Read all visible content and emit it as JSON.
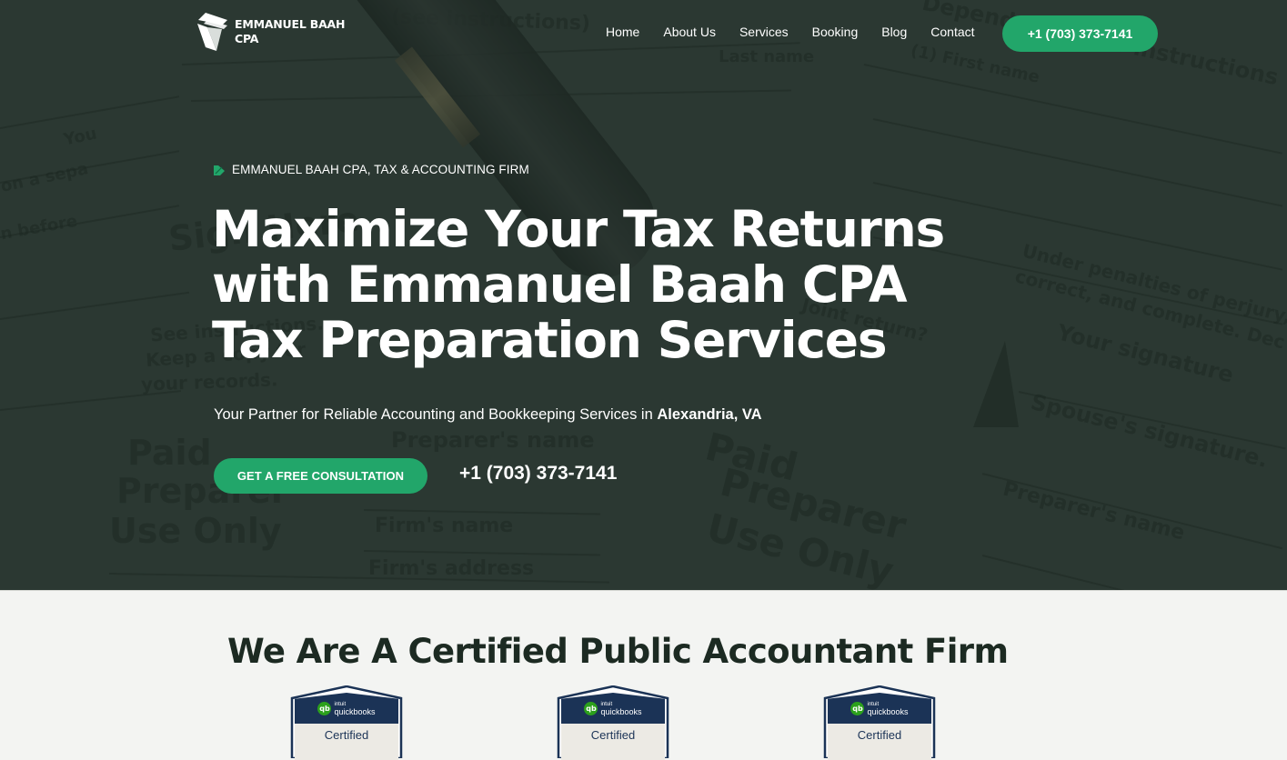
{
  "header": {
    "logo_line1": "EMMANUEL BAAH",
    "logo_line2": "CPA",
    "nav": [
      {
        "label": "Home"
      },
      {
        "label": "About Us"
      },
      {
        "label": "Services"
      },
      {
        "label": "Booking"
      },
      {
        "label": "Blog"
      },
      {
        "label": "Contact"
      }
    ],
    "phone_button": "+1 (703) 373-7141"
  },
  "hero": {
    "eyebrow": "EMMANUEL BAAH CPA, TAX & ACCOUNTING FIRM",
    "headline_lines": [
      "Maximize Your Tax Returns",
      "with Emmanuel Baah CPA",
      "Tax Preparation Services"
    ],
    "subline_prefix": "Your Partner for Reliable Accounting and Bookkeeping Services in ",
    "subline_location": "Alexandria, VA",
    "cta_label": "GET A FREE CONSULTATION",
    "phone": "+1 (703) 373-7141",
    "background_texts": [
      "(see instructions)",
      "Last name",
      "Dependents (see instructions",
      "(1) First name",
      "Sign Here",
      "Joint return?",
      "See instructions.",
      "Keep a copy for",
      "your records.",
      "Under penalties of perjury,",
      "correct, and complete. Dec",
      "Your signature",
      "Spouse's signature.",
      "Paid",
      "Preparer",
      "Use Only",
      "Preparer's name",
      "Firm's name",
      "Firm's address",
      "on a sepa",
      "n before",
      "You"
    ]
  },
  "certified_section": {
    "title": "We Are A Certified Public Accountant Firm",
    "badges": [
      {
        "brand_small": "intuit",
        "brand": "quickbooks",
        "label": "Certified"
      },
      {
        "brand_small": "intuit",
        "brand": "quickbooks",
        "label": "Certified"
      },
      {
        "brand_small": "intuit",
        "brand": "quickbooks",
        "label": "Certified"
      }
    ]
  },
  "colors": {
    "accent_green": "#22a66a",
    "hero_overlay": "#2f3b36",
    "section_bg": "#f3f4f2",
    "title_dark": "#1c2a22",
    "badge_navy": "#1b3356",
    "quickbooks_green": "#2ca01c"
  }
}
